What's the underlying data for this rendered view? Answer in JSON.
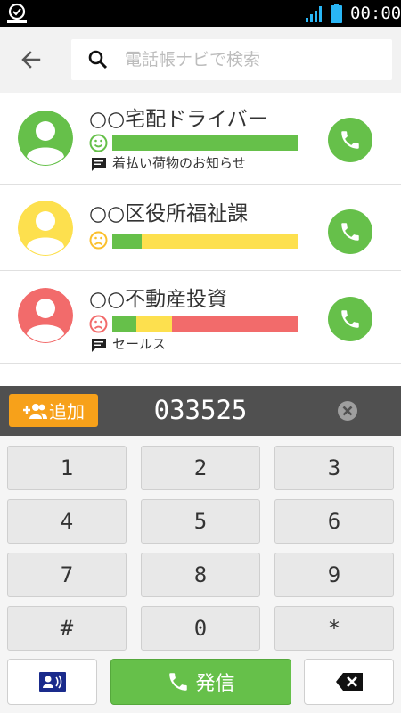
{
  "status_bar": {
    "time": "00:00",
    "icons": [
      "app-notification-icon",
      "signal-icon",
      "battery-icon"
    ]
  },
  "header": {
    "back_icon": "arrow-left-icon",
    "search_icon": "magnifier-icon",
    "search_placeholder": "電話帳ナビで検索",
    "search_value": ""
  },
  "contacts": [
    {
      "name": "○○宅配ドライバー",
      "avatar_color": "#66c04a",
      "face": "smile",
      "face_color": "#66c04a",
      "rating_segments": [
        {
          "color": "#66c04a",
          "fraction": 1.0
        }
      ],
      "note": "着払い荷物のお知らせ"
    },
    {
      "name": "○○区役所福祉課",
      "avatar_color": "#fde04e",
      "face": "frown",
      "face_color": "#fbc02d",
      "rating_segments": [
        {
          "color": "#66c04a",
          "fraction": 0.16
        },
        {
          "color": "#fde04e",
          "fraction": 0.84
        }
      ],
      "note": ""
    },
    {
      "name": "○○不動産投資",
      "avatar_color": "#f26b6b",
      "face": "frown",
      "face_color": "#f26b6b",
      "rating_segments": [
        {
          "color": "#66c04a",
          "fraction": 0.13
        },
        {
          "color": "#fde04e",
          "fraction": 0.19
        },
        {
          "color": "#f26b6b",
          "fraction": 0.68
        }
      ],
      "note": "セールス"
    }
  ],
  "number_bar": {
    "add_label": "追加",
    "dialed_number": "033525"
  },
  "keypad": {
    "keys": [
      "1",
      "2",
      "3",
      "4",
      "5",
      "6",
      "7",
      "8",
      "9",
      "#",
      "0",
      "*"
    ],
    "dial_label": "発信"
  },
  "colors": {
    "accent_green": "#66c04a",
    "accent_orange": "#f7a11a",
    "number_bar_bg": "#505050",
    "contacts_book_icon": "#1a2b8c"
  }
}
